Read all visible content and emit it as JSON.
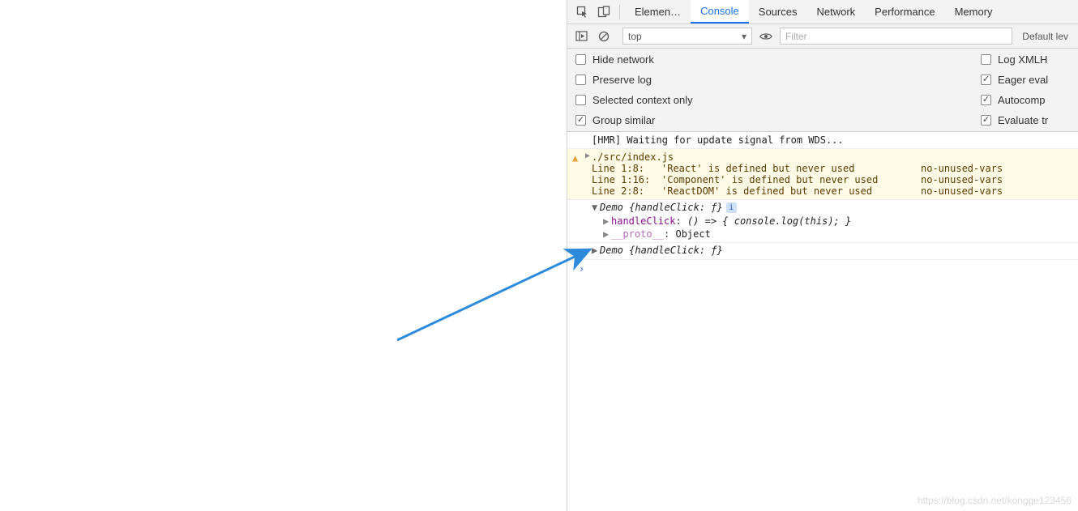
{
  "tabs": {
    "items": [
      {
        "label": "Elemen…"
      },
      {
        "label": "Console"
      },
      {
        "label": "Sources"
      },
      {
        "label": "Network"
      },
      {
        "label": "Performance"
      },
      {
        "label": "Memory"
      }
    ],
    "active_index": 1
  },
  "filter_bar": {
    "context": "top",
    "filter_placeholder": "Filter",
    "levels": "Default lev"
  },
  "options": {
    "left": [
      {
        "label": "Hide network",
        "checked": false
      },
      {
        "label": "Preserve log",
        "checked": false
      },
      {
        "label": "Selected context only",
        "checked": false
      },
      {
        "label": "Group similar",
        "checked": true
      }
    ],
    "right": [
      {
        "label": "Log XMLH",
        "checked": false
      },
      {
        "label": "Eager eval",
        "checked": true
      },
      {
        "label": "Autocomp",
        "checked": true
      },
      {
        "label": "Evaluate tr",
        "checked": true
      }
    ]
  },
  "log": {
    "hmr": "[HMR] Waiting for update signal from WDS...",
    "warning": {
      "file": "./src/index.js",
      "lines": [
        {
          "loc": "Line 1:8:",
          "msg": "'React' is defined but never used",
          "rule": "no-unused-vars"
        },
        {
          "loc": "Line 1:16:",
          "msg": "'Component' is defined but never used",
          "rule": "no-unused-vars"
        },
        {
          "loc": "Line 2:8:",
          "msg": "'ReactDOM' is defined but never used",
          "rule": "no-unused-vars"
        }
      ]
    },
    "objects": [
      {
        "summary_name": "Demo",
        "summary_rest": " {handleClick: ƒ}",
        "expanded": true,
        "props": [
          {
            "tri": "▶",
            "key": "handleClick",
            "val": "() => { console.log(this); }",
            "kind": "fn"
          },
          {
            "tri": "▶",
            "key": "__proto__",
            "val": "Object",
            "kind": "proto"
          }
        ]
      },
      {
        "summary_name": "Demo",
        "summary_rest": " {handleClick: ƒ}",
        "expanded": false
      }
    ]
  },
  "watermark": "https://blog.csdn.net/kongge123456"
}
